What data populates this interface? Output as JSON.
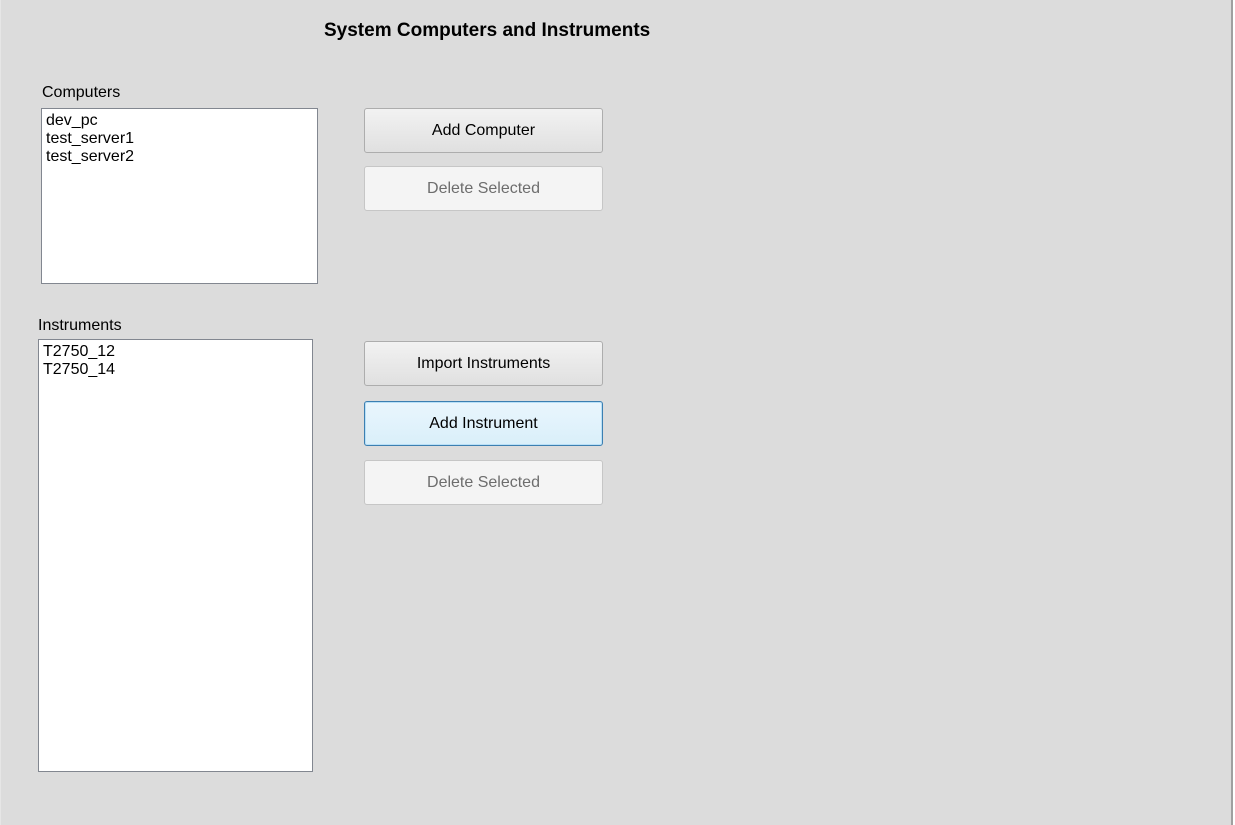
{
  "title": "System Computers and Instruments",
  "computers": {
    "label": "Computers",
    "items": [
      "dev_pc",
      "test_server1",
      "test_server2"
    ],
    "add_button": "Add Computer",
    "delete_button": "Delete Selected"
  },
  "instruments": {
    "label": "Instruments",
    "items": [
      "T2750_12",
      "T2750_14"
    ],
    "import_button": "Import Instruments",
    "add_button": "Add Instrument",
    "delete_button": "Delete Selected"
  }
}
